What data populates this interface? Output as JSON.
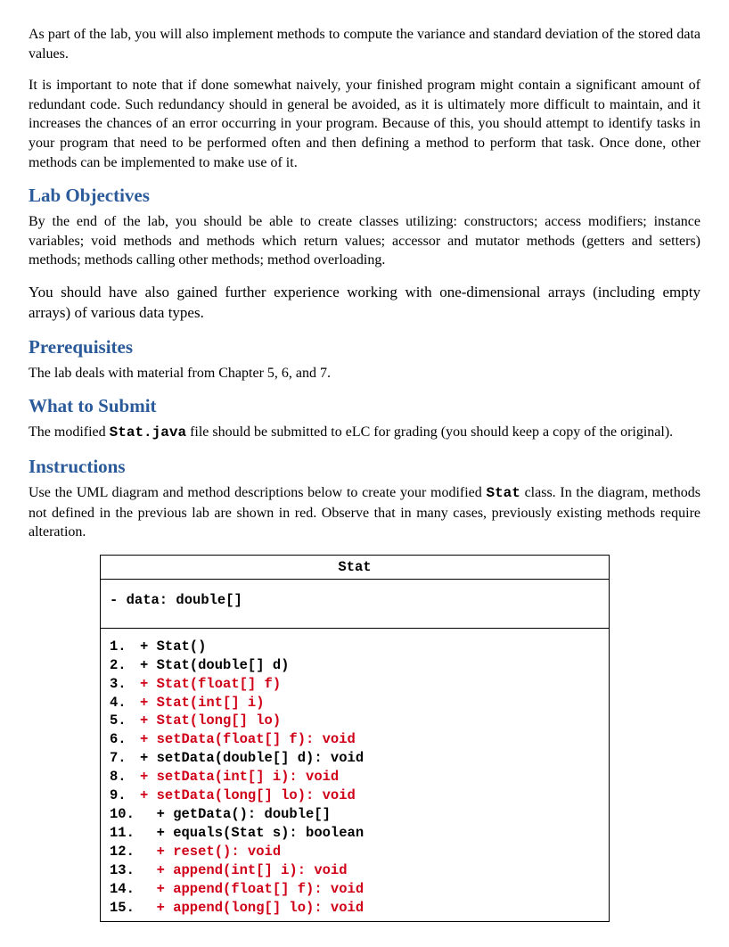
{
  "intro": {
    "p1": "As part of the lab, you will also implement methods to compute the variance and standard deviation of the stored data values.",
    "p2": "It is important to note that if done somewhat naively, your finished program might contain a significant amount of redundant code. Such redundancy should in general be avoided, as it is ultimately more difficult to maintain, and it increases the chances of an error occurring in your program. Because of this, you should attempt to identify tasks in your program that need to be performed often and then defining a method to perform that task. Once done, other methods can be implemented to make use of it."
  },
  "objectives": {
    "heading": "Lab Objectives",
    "p1": "By the end of the lab, you should be able to create classes utilizing:  constructors; access modifiers; instance variables; void methods and methods which return values; accessor and mutator methods (getters and setters) methods; methods calling other methods; method overloading.",
    "p2": "You should have also gained further experience working with one-dimensional arrays (including empty arrays) of various data types."
  },
  "prereq": {
    "heading": "Prerequisites",
    "p1": "The lab deals with material from Chapter 5, 6, and 7."
  },
  "submit": {
    "heading": "What to Submit",
    "prefix": "The modified ",
    "code": "Stat.java",
    "suffix": " file should be submitted to eLC for grading (you should keep a copy of the original)."
  },
  "instructions": {
    "heading": "Instructions",
    "prefix": "Use the UML diagram and method descriptions below to create your modified ",
    "code": "Stat",
    "suffix": " class. In the diagram, methods not defined in the previous lab are shown in red. Observe that in many cases, previously existing methods require alteration."
  },
  "uml": {
    "title": "Stat",
    "attribute": "- data: double[]",
    "methods": [
      {
        "num": "1.",
        "sig": "+ Stat()",
        "color": "blk"
      },
      {
        "num": "2.",
        "sig": "+ Stat(double[] d)",
        "color": "blk"
      },
      {
        "num": "3.",
        "sig": "+ Stat(float[] f)",
        "color": "red"
      },
      {
        "num": "4.",
        "sig": "+ Stat(int[] i)",
        "color": "red"
      },
      {
        "num": "5.",
        "sig": "+ Stat(long[] lo)",
        "color": "red"
      },
      {
        "num": "6.",
        "sig": "+ setData(float[] f): void",
        "color": "red"
      },
      {
        "num": "7.",
        "sig": "+ setData(double[] d): void",
        "color": "blk"
      },
      {
        "num": "8.",
        "sig": "+ setData(int[] i): void",
        "color": "red"
      },
      {
        "num": "9.",
        "sig": "+ setData(long[] lo): void",
        "color": "red"
      },
      {
        "num": "10.",
        "sig": "  + getData(): double[]",
        "color": "blk"
      },
      {
        "num": "11.",
        "sig": "  + equals(Stat s): boolean",
        "color": "blk"
      },
      {
        "num": "12.",
        "sig": "  + reset(): void",
        "color": "red"
      },
      {
        "num": "13.",
        "sig": "  + append(int[] i): void",
        "color": "red"
      },
      {
        "num": "14.",
        "sig": "  + append(float[] f): void",
        "color": "red"
      },
      {
        "num": "15.",
        "sig": "  + append(long[] lo): void",
        "color": "red"
      }
    ]
  }
}
